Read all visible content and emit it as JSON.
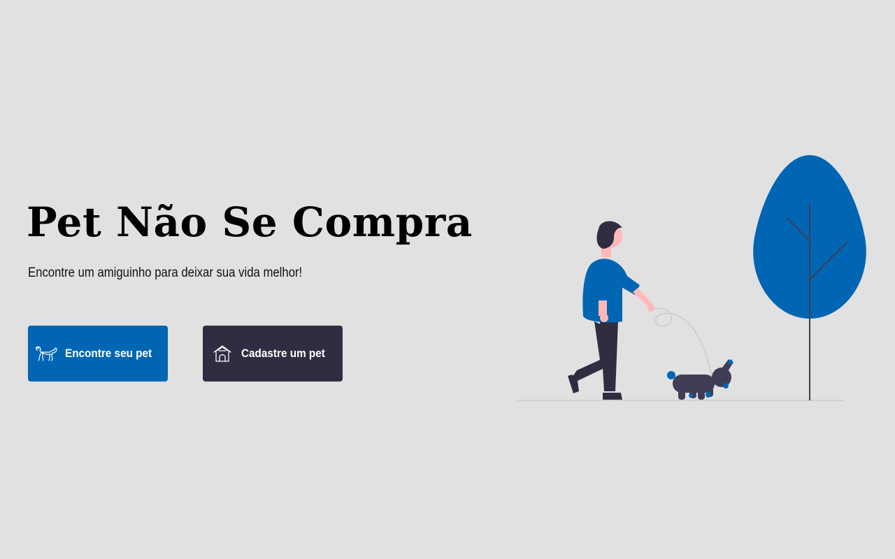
{
  "hero": {
    "title": "Pet Não Se Compra",
    "subtitle": "Encontre um amiguinho para deixar sua vida melhor!"
  },
  "buttons": [
    {
      "label": "Encontre seu pet",
      "icon": "dog-icon",
      "color": "#0066b3"
    },
    {
      "label": "Cadastre um pet",
      "icon": "doghouse-icon",
      "color": "#2f2d41"
    }
  ],
  "illustration": {
    "description_icon": "person-walking-dog-illustration",
    "colors": {
      "accent": "#0066b3",
      "dark": "#2f2d41",
      "skin": "#ffb8b8",
      "background": "#e1e1e1"
    }
  }
}
